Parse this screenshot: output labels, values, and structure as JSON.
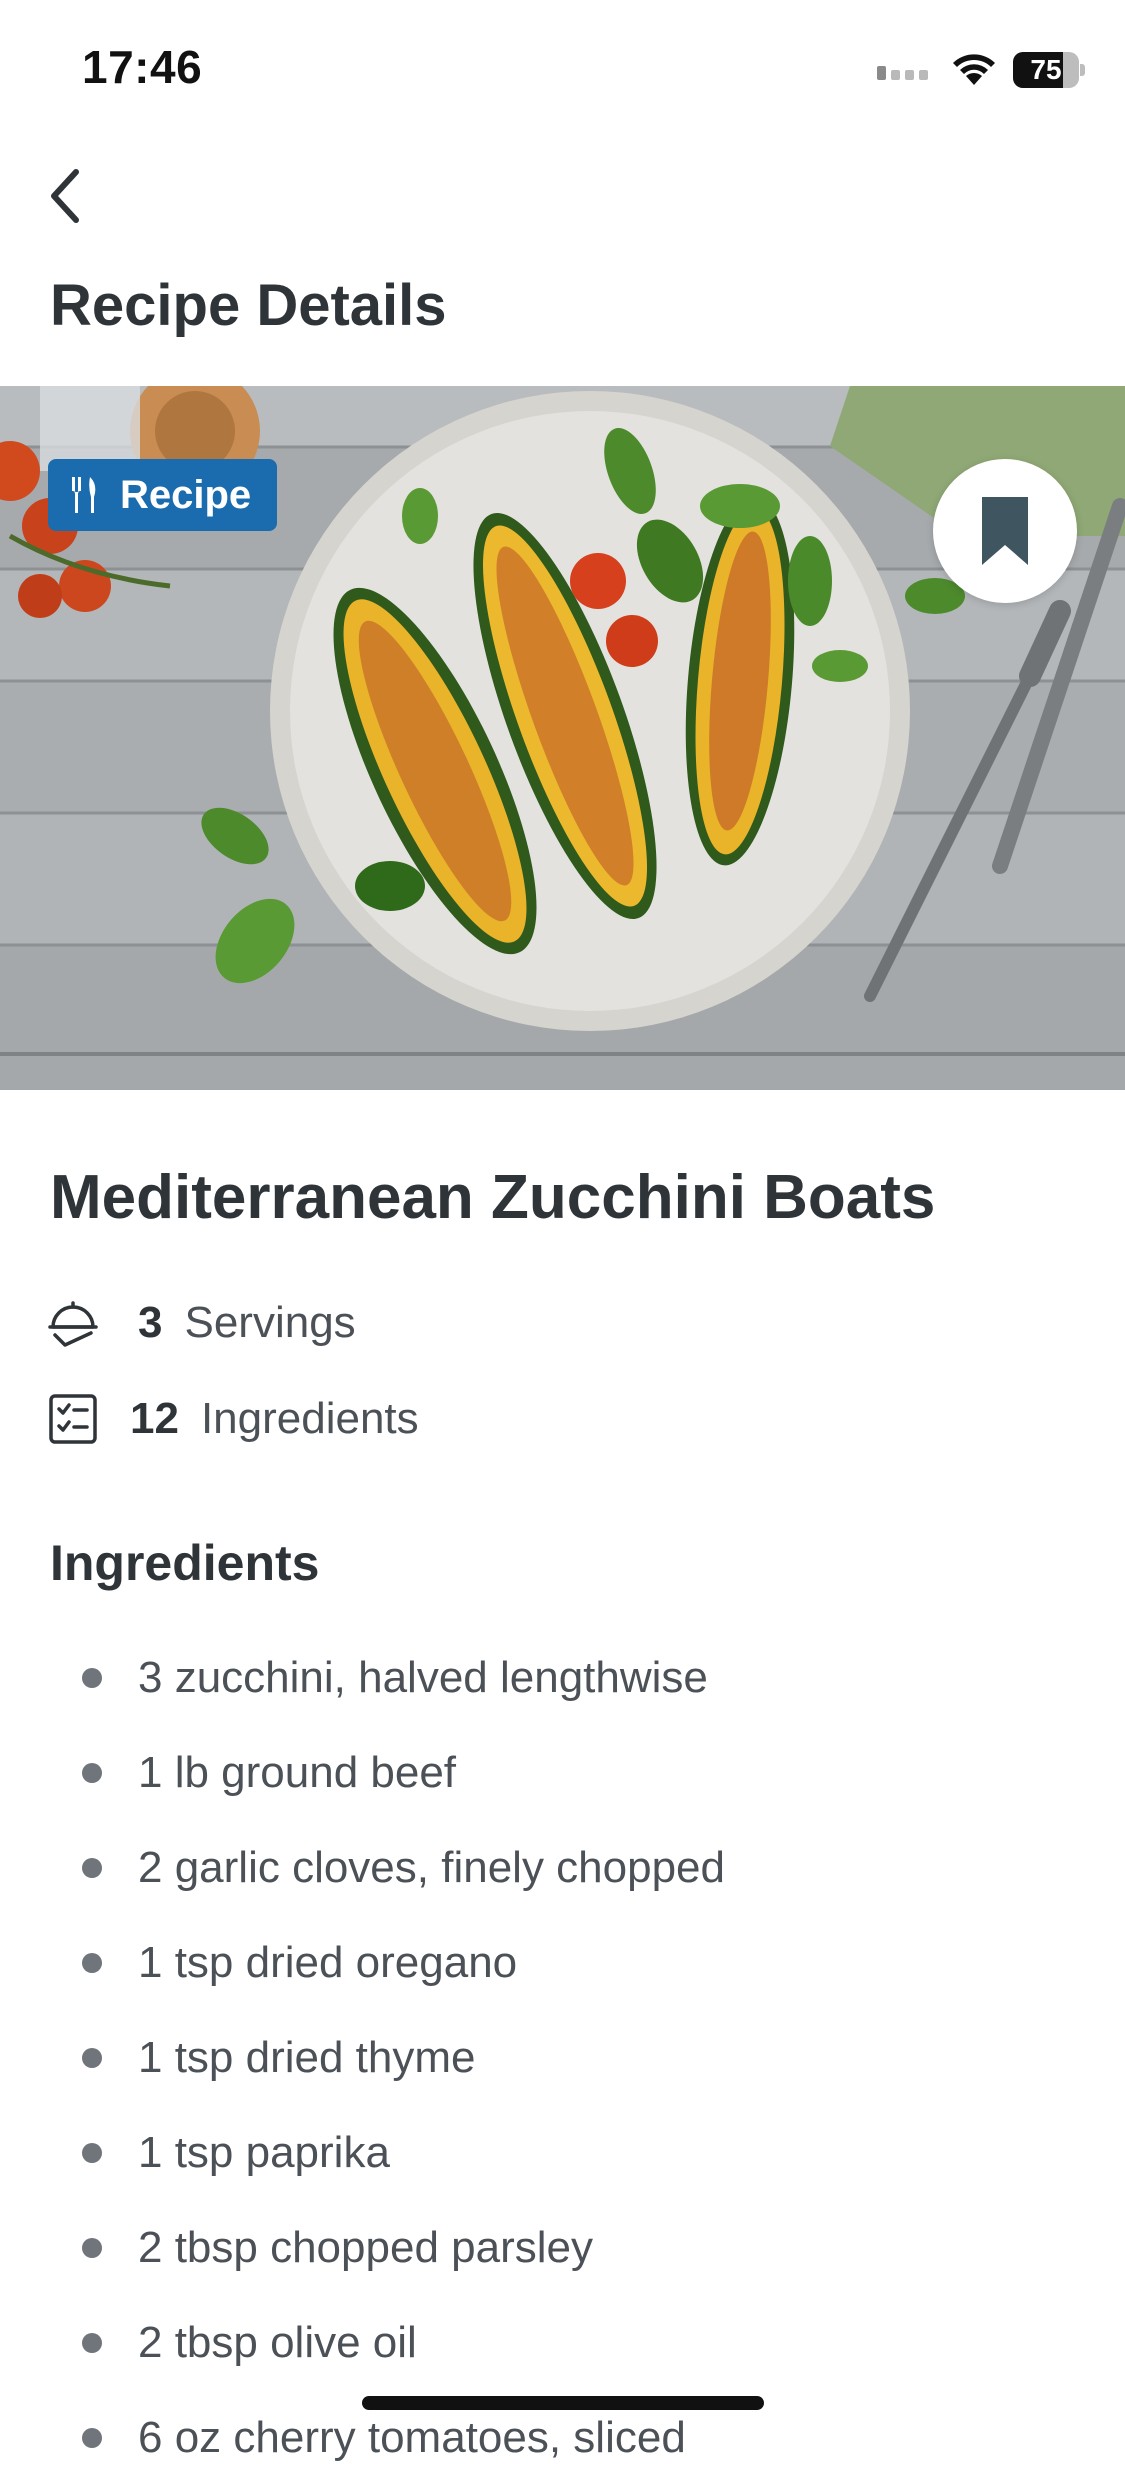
{
  "status_bar": {
    "time": "17:46",
    "battery_level": "75",
    "icons": [
      "signal-icon",
      "wifi-icon",
      "battery-icon"
    ]
  },
  "header": {
    "back_icon": "chevron-left-icon",
    "title": "Recipe Details"
  },
  "hero": {
    "badge_icon": "fork-knife-icon",
    "badge_label": "Recipe",
    "bookmark_icon": "bookmark-icon"
  },
  "recipe": {
    "title": "Mediterranean Zucchini Boats",
    "servings_icon": "serving-dish-icon",
    "servings_count": "3",
    "servings_label": "Servings",
    "ingredients_icon": "checklist-icon",
    "ingredients_count": "12",
    "ingredients_label": "Ingredients"
  },
  "ingredients_section": {
    "title": "Ingredients",
    "items": [
      "3 zucchini, halved lengthwise",
      "1 lb ground beef",
      "2 garlic cloves, finely chopped",
      "1 tsp dried oregano",
      "1 tsp dried thyme",
      "1 tsp paprika",
      "2 tbsp chopped parsley",
      "2 tbsp olive oil",
      "6 oz cherry tomatoes, sliced"
    ]
  },
  "colors": {
    "accent": "#1a6cae",
    "bookmark": "#3f5560",
    "text": "#2f3439"
  }
}
